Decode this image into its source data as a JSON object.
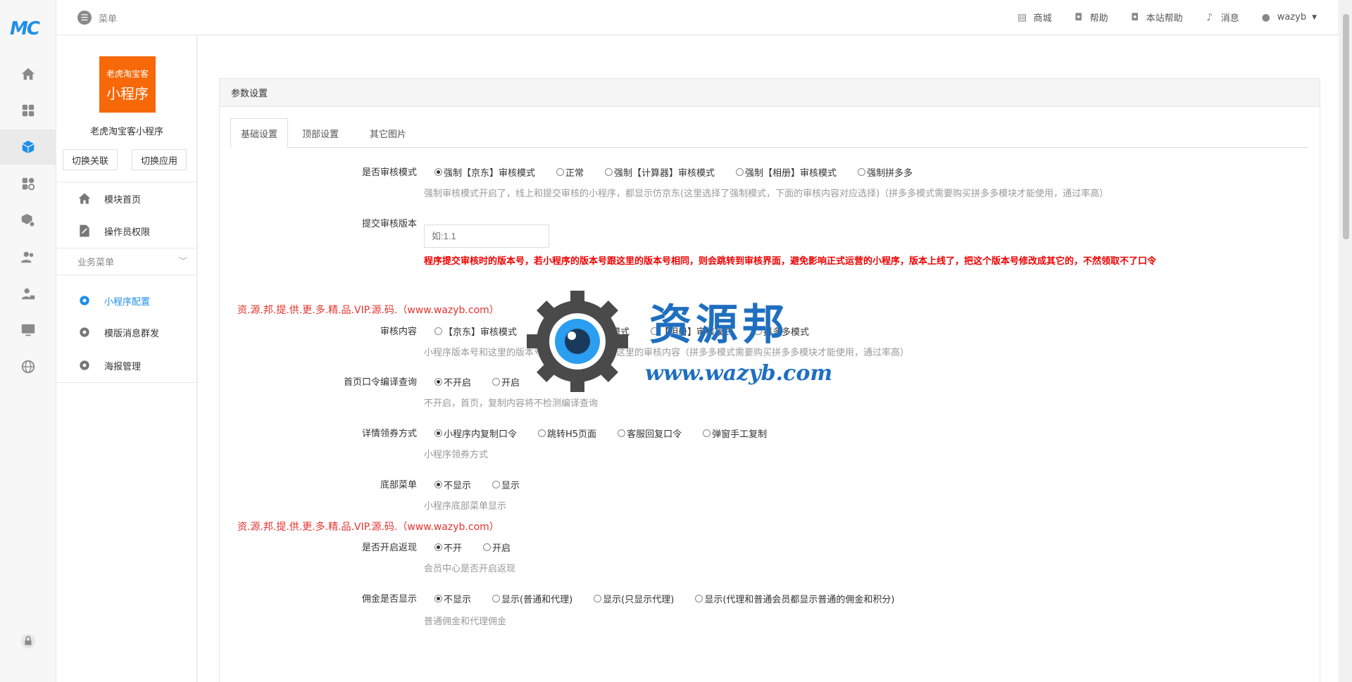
{
  "rail": {
    "logo": "MC",
    "icons": [
      "home-icon",
      "apps-icon",
      "cube-icon",
      "plugins-icon",
      "package-settings-icon",
      "users-icon",
      "user-admin-icon",
      "monitor-icon",
      "globe-icon",
      "lock-icon"
    ],
    "active_index": 2
  },
  "topbar": {
    "menu_label": "菜单",
    "items": [
      {
        "label": "商城",
        "icon": "store-icon"
      },
      {
        "label": "帮助",
        "icon": "help-bag-icon"
      },
      {
        "label": "本站帮助",
        "icon": "site-help-icon"
      },
      {
        "label": "消息",
        "icon": "bell-icon"
      },
      {
        "label": "wazyb",
        "icon": "user-icon"
      }
    ]
  },
  "sidebar": {
    "app_logo_line1": "老虎淘宝客",
    "app_logo_line2": "小程序",
    "app_name": "老虎淘宝客小程序",
    "switch_link": "切换关联",
    "switch_app": "切换应用",
    "nav_top": [
      {
        "label": "模块首页",
        "icon": "home-icon"
      },
      {
        "label": "操作员权限",
        "icon": "edit-document-icon"
      }
    ],
    "group_label": "业务菜单",
    "nav_group": [
      {
        "label": "小程序配置",
        "icon": "gear-icon",
        "active": true
      },
      {
        "label": "模版消息群发",
        "icon": "gear-icon",
        "active": false
      },
      {
        "label": "海报管理",
        "icon": "gear-icon",
        "active": false
      }
    ]
  },
  "panel": {
    "title": "参数设置",
    "tabs": [
      "基础设置",
      "顶部设置",
      "其它图片"
    ]
  },
  "form": {
    "review_mode": {
      "label": "是否审核模式",
      "options": [
        "强制【京东】审核模式",
        "正常",
        "强制【计算器】审核模式",
        "强制【相册】审核模式",
        "强制拼多多"
      ],
      "selected": 0,
      "help": "强制审核模式开启了，线上和提交审核的小程序，都显示仿京东(这里选择了强制模式，下面的审核内容对应选择)（拼多多模式需要购买拼多多模块才能使用，通过率高）"
    },
    "review_version": {
      "label": "提交审核版本",
      "placeholder": "如:1.1",
      "warning": "程序提交审核时的版本号，若小程序的版本号跟这里的版本号相同，则会跳转到审核界面，避免影响正式运营的小程序，版本上线了，把这个版本号修改成其它的，不然领取不了口令"
    },
    "watermark_text": "资.源.邦.提.供.更.多.精.品.VIP.源.码.（www.wazyb.com）",
    "review_content": {
      "label": "审核内容",
      "options": [
        "【京东】审核模式",
        "【计算器】审核模式",
        "【相册】审核模式",
        "拼多多模式"
      ],
      "selected": -1,
      "help": "小程序版本号和这里的版本号相同时，就会显示这里的审核内容（拼多多模式需要购买拼多多模块才能使用，通过率高）"
    },
    "home_command": {
      "label": "首页口令编译查询",
      "options": [
        "不开启",
        "开启"
      ],
      "selected": 0,
      "help": "不开启，首页，复制内容将不检测编译查询"
    },
    "coupon_method": {
      "label": "详情领券方式",
      "options": [
        "小程序内复制口令",
        "跳转H5页面",
        "客服回复口令",
        "弹窗手工复制"
      ],
      "selected": 0,
      "help": "小程序领券方式"
    },
    "bottom_menu": {
      "label": "底部菜单",
      "options": [
        "不显示",
        "显示"
      ],
      "selected": 0,
      "help": "小程序底部菜单显示"
    },
    "cashback": {
      "label": "是否开启返现",
      "options": [
        "不开",
        "开启"
      ],
      "selected": 0,
      "help": "会员中心是否开启返现"
    },
    "commission": {
      "label": "佣金是否显示",
      "options": [
        "不显示",
        "显示(普通和代理)",
        "显示(只显示代理)",
        "显示(代理和普通会员都显示普通的佣金和积分)"
      ],
      "selected": 0,
      "help": "普通佣金和代理佣金"
    }
  },
  "watermark": {
    "brand": "资源邦",
    "url": "www.wazyb.com"
  }
}
